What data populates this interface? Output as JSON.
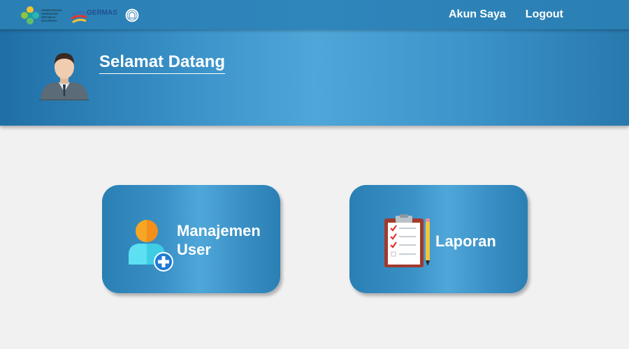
{
  "logos": {
    "kemenkes_text": [
      "KEMENTERIAN",
      "KESEHATAN",
      "REPUBLIK",
      "INDONESIA"
    ],
    "germas_text": "GERMAS"
  },
  "nav": {
    "account_label": "Akun Saya",
    "logout_label": "Logout"
  },
  "hero": {
    "title": "Selamat Datang"
  },
  "menu": [
    {
      "label": "Manajemen User",
      "icon": "add-user-icon"
    },
    {
      "label": "Laporan",
      "icon": "clipboard-checklist-icon"
    }
  ],
  "colors": {
    "primary": "#2a7fb3",
    "highlight": "#4fa7d9",
    "background": "#f2f1f2",
    "text_on_primary": "#ffffff"
  }
}
